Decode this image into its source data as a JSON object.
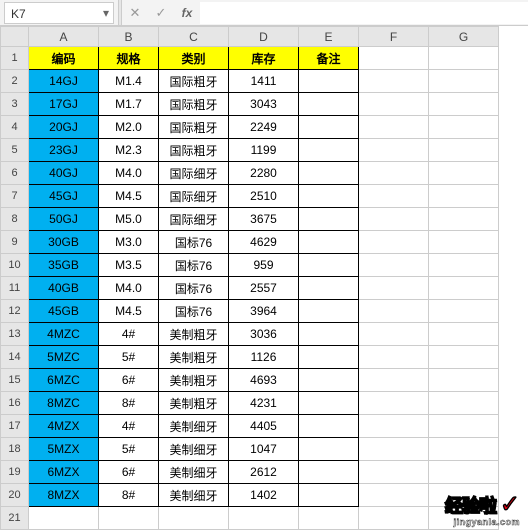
{
  "nameBox": "K7",
  "formula": "",
  "columns": [
    "A",
    "B",
    "C",
    "D",
    "E",
    "F",
    "G"
  ],
  "header": {
    "A": "编码",
    "B": "规格",
    "C": "类别",
    "D": "库存",
    "E": "备注"
  },
  "rows": [
    {
      "code": "14GJ",
      "spec": "M1.4",
      "cat": "国际粗牙",
      "stock": "1411",
      "note": ""
    },
    {
      "code": "17GJ",
      "spec": "M1.7",
      "cat": "国际粗牙",
      "stock": "3043",
      "note": ""
    },
    {
      "code": "20GJ",
      "spec": "M2.0",
      "cat": "国际粗牙",
      "stock": "2249",
      "note": ""
    },
    {
      "code": "23GJ",
      "spec": "M2.3",
      "cat": "国际粗牙",
      "stock": "1199",
      "note": ""
    },
    {
      "code": "40GJ",
      "spec": "M4.0",
      "cat": "国际细牙",
      "stock": "2280",
      "note": ""
    },
    {
      "code": "45GJ",
      "spec": "M4.5",
      "cat": "国际细牙",
      "stock": "2510",
      "note": ""
    },
    {
      "code": "50GJ",
      "spec": "M5.0",
      "cat": "国际细牙",
      "stock": "3675",
      "note": ""
    },
    {
      "code": "30GB",
      "spec": "M3.0",
      "cat": "国标76",
      "stock": "4629",
      "note": ""
    },
    {
      "code": "35GB",
      "spec": "M3.5",
      "cat": "国标76",
      "stock": "959",
      "note": ""
    },
    {
      "code": "40GB",
      "spec": "M4.0",
      "cat": "国标76",
      "stock": "2557",
      "note": ""
    },
    {
      "code": "45GB",
      "spec": "M4.5",
      "cat": "国标76",
      "stock": "3964",
      "note": ""
    },
    {
      "code": "4MZC",
      "spec": "4#",
      "cat": "美制粗牙",
      "stock": "3036",
      "note": ""
    },
    {
      "code": "5MZC",
      "spec": "5#",
      "cat": "美制粗牙",
      "stock": "1126",
      "note": ""
    },
    {
      "code": "6MZC",
      "spec": "6#",
      "cat": "美制粗牙",
      "stock": "4693",
      "note": ""
    },
    {
      "code": "8MZC",
      "spec": "8#",
      "cat": "美制粗牙",
      "stock": "4231",
      "note": ""
    },
    {
      "code": "4MZX",
      "spec": "4#",
      "cat": "美制细牙",
      "stock": "4405",
      "note": ""
    },
    {
      "code": "5MZX",
      "spec": "5#",
      "cat": "美制细牙",
      "stock": "1047",
      "note": ""
    },
    {
      "code": "6MZX",
      "spec": "6#",
      "cat": "美制细牙",
      "stock": "2612",
      "note": ""
    },
    {
      "code": "8MZX",
      "spec": "8#",
      "cat": "美制细牙",
      "stock": "1402",
      "note": ""
    }
  ],
  "totalRowsShown": 21,
  "watermark": {
    "text": "经验啦",
    "check": "✓",
    "url": "jingyanla.com"
  }
}
